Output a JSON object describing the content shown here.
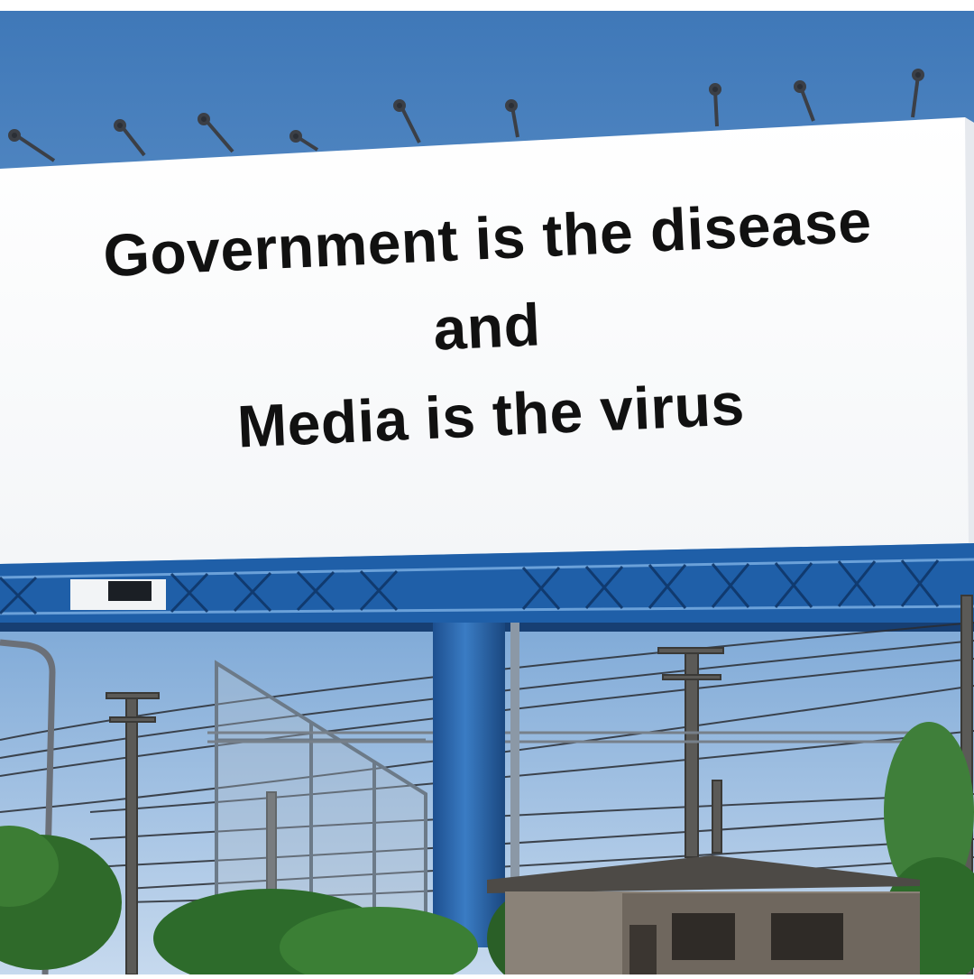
{
  "billboard": {
    "line_1": "Government is the disease",
    "line_2": "and",
    "line_3": "Media is the virus"
  },
  "colors": {
    "sky": "#4d83bf",
    "billboard_face": "#ffffff",
    "steel_frame": "#2a67b2",
    "text": "#111111"
  }
}
